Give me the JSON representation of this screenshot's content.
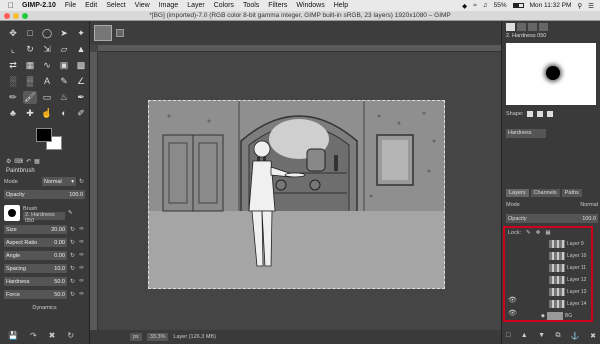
{
  "menubar": {
    "app": "GIMP-2.10",
    "items": [
      "File",
      "Edit",
      "Select",
      "View",
      "Image",
      "Layer",
      "Colors",
      "Tools",
      "Filters",
      "Windows",
      "Help"
    ],
    "battery": "55%",
    "clock": "Mon 11:32 PM"
  },
  "window_title": "*[BG] (imported)-7.0 (RGB color 8-bit gamma integer, GIMP built-in sRGB, 23 layers) 1920x1080 – GIMP",
  "tool_options": {
    "title": "Paintbrush",
    "mode_label": "Mode",
    "mode_value": "Normal",
    "opacity_label": "Opacity",
    "opacity_value": "100.0",
    "brush_label": "Brush",
    "brush_value": "2. Hardness 050",
    "size_label": "Size",
    "size_value": "20.00",
    "aspect_label": "Aspect Ratio",
    "aspect_value": "0.00",
    "angle_label": "Angle",
    "angle_value": "0.00",
    "spacing_label": "Spacing",
    "spacing_value": "10.0",
    "hardness_label": "Hardness",
    "hardness_value": "50.0",
    "force_label": "Force",
    "force_value": "50.0",
    "dynamics_label": "Dynamics"
  },
  "statusbar": {
    "unit": "px",
    "zoom": "33.3%",
    "info": "Layer (126.3 MB)"
  },
  "brushes_panel": {
    "brush_name": "2. Hardness 050",
    "shape_label": "Shape:",
    "hardness_label": "Hardness"
  },
  "layers_panel": {
    "tabs": [
      "Layers",
      "Channels",
      "Paths"
    ],
    "mode_label": "Mode",
    "mode_value": "Normal",
    "opacity_label": "Opacity",
    "opacity_value": "100.0",
    "lock_label": "Lock:",
    "layers": [
      "Layer 9",
      "Layer 10",
      "Layer 11",
      "Layer 12",
      "Layer 13",
      "Layer 14",
      "BG"
    ]
  }
}
